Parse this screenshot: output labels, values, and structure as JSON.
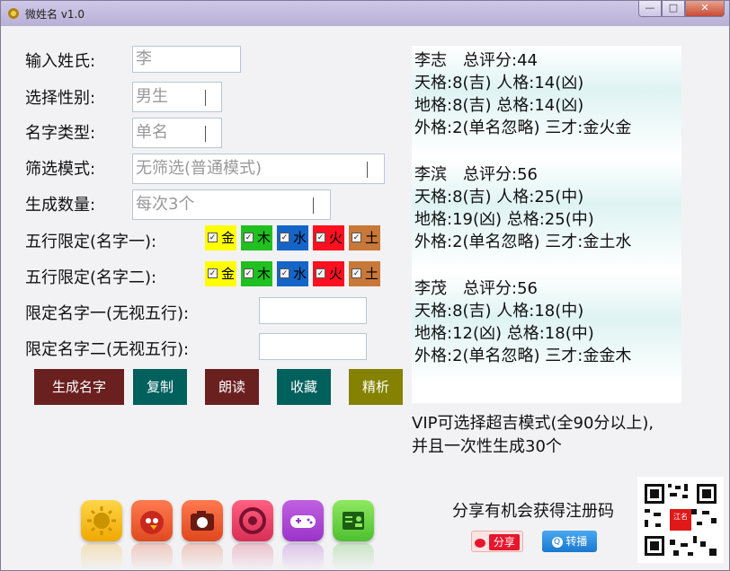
{
  "window": {
    "title": "微姓名 v1.0",
    "controls": {
      "minimize": "—",
      "maximize": "□",
      "close": "✕"
    }
  },
  "form": {
    "surname_label": "输入姓氏:",
    "surname_value": "李",
    "gender_label": "选择性别:",
    "gender_value": "男生",
    "name_type_label": "名字类型:",
    "name_type_value": "单名",
    "filter_label": "筛选模式:",
    "filter_value": "无筛选(普通模式)",
    "count_label": "生成数量:",
    "count_value": "每次3个",
    "wuxing1_label": "五行限定(名字一):",
    "wuxing2_label": "五行限定(名字二):",
    "wuxing_options": [
      {
        "label": "金",
        "color": "#ffff00",
        "checked": true
      },
      {
        "label": "木",
        "color": "#20c020",
        "checked": true
      },
      {
        "label": "水",
        "color": "#1565c8",
        "checked": true
      },
      {
        "label": "火",
        "color": "#ff1020",
        "checked": true
      },
      {
        "label": "土",
        "color": "#c87838",
        "checked": true
      }
    ],
    "fixed1_label": "限定名字一(无视五行):",
    "fixed1_value": "",
    "fixed2_label": "限定名字二(无视五行):",
    "fixed2_value": ""
  },
  "buttons": {
    "generate": "生成名字",
    "copy": "复制",
    "read": "朗读",
    "favorite": "收藏",
    "refine": "精析",
    "colors": {
      "generate": "#6b2020",
      "copy": "#00605c",
      "read": "#6b2020",
      "favorite": "#00605c",
      "refine": "#848200"
    }
  },
  "results": [
    {
      "line1": "李志　总评分:44",
      "line2": "天格:8(吉) 人格:14(凶)",
      "line3": "地格:8(吉) 总格:14(凶)",
      "line4": "外格:2(单名忽略) 三才:金火金"
    },
    {
      "line1": "李滨　总评分:56",
      "line2": "天格:8(吉) 人格:25(中)",
      "line3": "地格:19(凶) 总格:25(中)",
      "line4": "外格:2(单名忽略) 三才:金土水"
    },
    {
      "line1": "李茂　总评分:56",
      "line2": "天格:8(吉) 人格:18(中)",
      "line3": "地格:12(凶) 总格:18(中)",
      "line4": "外格:2(单名忽略) 三才:金金木"
    }
  ],
  "vip": {
    "line1": "VIP可选择超吉模式(全90分以上),",
    "line2": "并且一次性生成30个"
  },
  "dock_icons": [
    "sun-app-icon",
    "angry-bird-app-icon",
    "camera-app-icon",
    "chrome-app-icon",
    "game-controller-app-icon",
    "contact-card-app-icon"
  ],
  "share": {
    "text": "分享有机会获得注册码",
    "weibo_label": "分享",
    "tencent_label": "转播",
    "qr_logo_text": "江名"
  }
}
